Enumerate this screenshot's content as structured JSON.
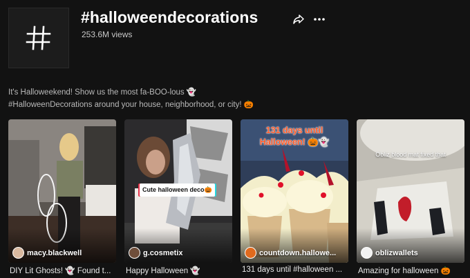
{
  "header": {
    "title": "#halloweendecorations",
    "views": "253.6M views",
    "hashtag_glyph": "#"
  },
  "description": {
    "line1": "It's Halloweekend! Show us the most fa-BOO-lous 👻",
    "line2": "#HalloweenDecorations around your house, neighborhood, or city! 🎃"
  },
  "videos": [
    {
      "author": "macy.blackwell",
      "caption": "DIY Lit Ghosts! 👻  Found t...",
      "overlay": ""
    },
    {
      "author": "g.cosmetix",
      "caption": "Happy Halloween 👻",
      "overlay": "Cute halloween deco🎃"
    },
    {
      "author": "countdown.hallowe...",
      "caption": "131 days until #halloween ...",
      "overlay": "131 days until Halloween! 🎃👻"
    },
    {
      "author": "oblizwallets",
      "caption": "Amazing for halloween 🎃",
      "overlay": "Obliz blood mat fixed that"
    }
  ],
  "colors": {
    "background": "#121212",
    "text_primary": "#ffffff",
    "text_secondary": "#b9b9b9",
    "overlay_orange": "#ff5c2a"
  },
  "icons": {
    "share": "share-icon",
    "more": "more-icon",
    "hashtag": "hashtag-icon"
  }
}
